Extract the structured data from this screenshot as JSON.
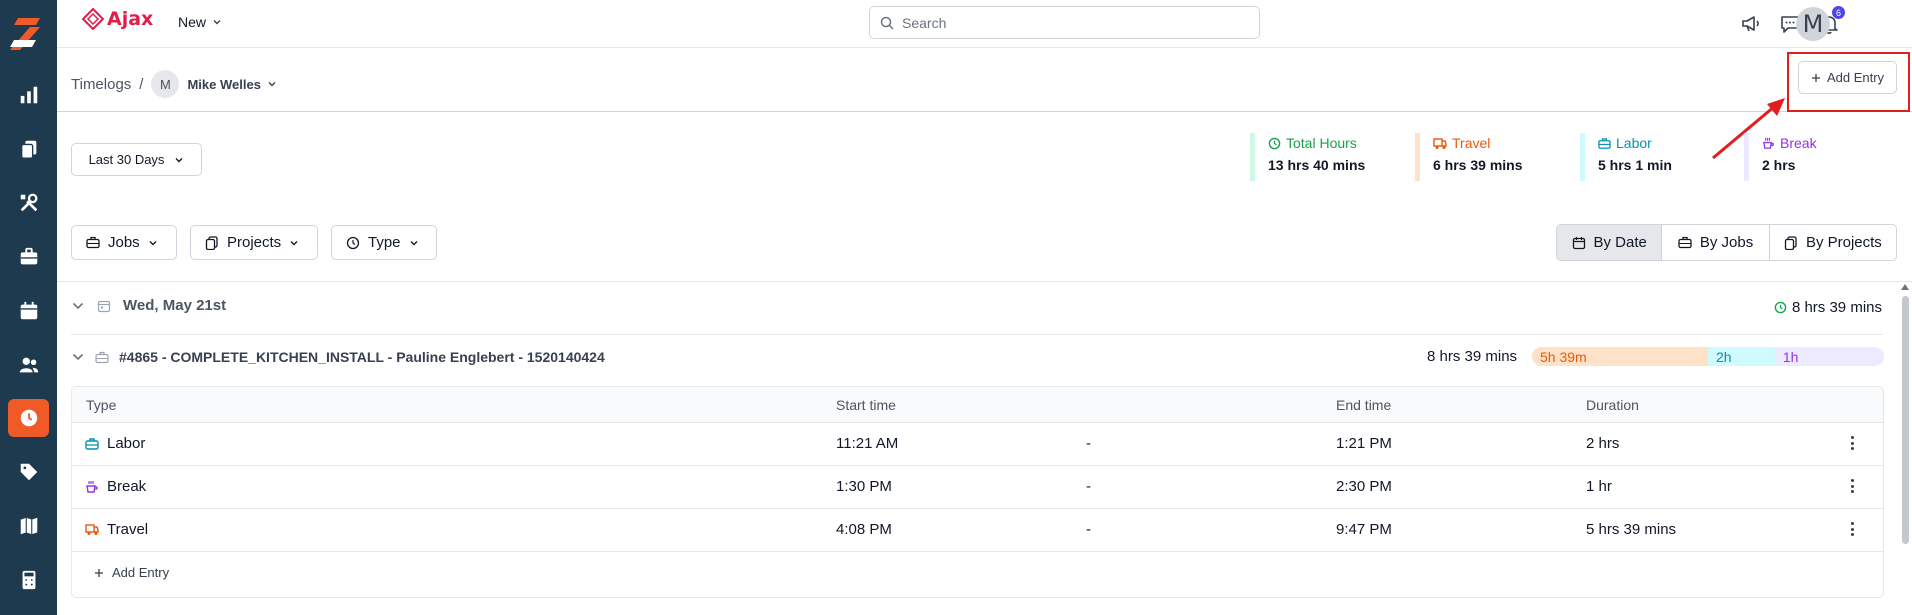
{
  "sidebar": {
    "items": [
      {
        "icon": "chart-icon",
        "active": false
      },
      {
        "icon": "documents-icon",
        "active": false
      },
      {
        "icon": "tools-icon",
        "active": false
      },
      {
        "icon": "briefcase-icon",
        "active": false
      },
      {
        "icon": "calendar-icon",
        "active": false
      },
      {
        "icon": "users-icon",
        "active": false
      },
      {
        "icon": "clock-icon",
        "active": true
      },
      {
        "icon": "tag-icon",
        "active": false
      },
      {
        "icon": "map-icon",
        "active": false
      },
      {
        "icon": "calculator-icon",
        "active": false
      }
    ],
    "active_color": "#f05a28",
    "bg_color": "#1e3a4f"
  },
  "topbar": {
    "brand": "Ajax",
    "new_label": "New",
    "search_placeholder": "Search",
    "notification_count": "6",
    "avatar_initial": "M"
  },
  "breadcrumb": {
    "root": "Timelogs",
    "separator": "/",
    "user_initial": "M",
    "user_name": "Mike Welles"
  },
  "add_entry_label": "Add Entry",
  "date_range": "Last 30 Days",
  "stats": [
    {
      "label": "Total Hours",
      "value": "13 hrs 40 mins",
      "color": "#16a34a",
      "bar_color": "#d1fae5",
      "icon": "clock-icon"
    },
    {
      "label": "Travel",
      "value": "6 hrs 39 mins",
      "color": "#ea580c",
      "bar_color": "#fde2c8",
      "icon": "truck-icon"
    },
    {
      "label": "Labor",
      "value": "5 hrs 1 min",
      "color": "#0891b2",
      "bar_color": "#cffafe",
      "icon": "toolbox-icon"
    },
    {
      "label": "Break",
      "value": "2 hrs",
      "color": "#9333ea",
      "bar_color": "#ede9fe",
      "icon": "coffee-icon"
    }
  ],
  "filters": {
    "jobs": "Jobs",
    "projects": "Projects",
    "type": "Type"
  },
  "views": {
    "by_date": "By Date",
    "by_jobs": "By Jobs",
    "by_projects": "By Projects",
    "active": "By Date"
  },
  "day_group": {
    "date": "Wed, May 21st",
    "total": "8 hrs 39 mins"
  },
  "job_group": {
    "title": "#4865 - COMPLETE_KITCHEN_INSTALL - Pauline Englebert - 1520140424",
    "total": "8 hrs 39 mins",
    "breakdown": [
      {
        "label": "5h 39m",
        "fraction": 0.5,
        "bg": "#fde2c8",
        "color": "#ea580c"
      },
      {
        "label": "2h",
        "fraction": 0.19,
        "bg": "#cffafe",
        "color": "#0891b2"
      },
      {
        "label": "1h",
        "fraction": 0.18,
        "bg": "#ede9fe",
        "color": "#9333ea"
      }
    ]
  },
  "table": {
    "headers": {
      "type": "Type",
      "start": "Start time",
      "end": "End time",
      "duration": "Duration"
    },
    "rows": [
      {
        "type": "Labor",
        "icon": "toolbox-icon",
        "icon_color": "#0891b2",
        "start": "11:21 AM",
        "sep": "-",
        "end": "1:21 PM",
        "duration": "2 hrs"
      },
      {
        "type": "Break",
        "icon": "coffee-icon",
        "icon_color": "#9333ea",
        "start": "1:30 PM",
        "sep": "-",
        "end": "2:30 PM",
        "duration": "1 hr"
      },
      {
        "type": "Travel",
        "icon": "truck-icon",
        "icon_color": "#ea580c",
        "start": "4:08 PM",
        "sep": "-",
        "end": "9:47 PM",
        "duration": "5 hrs 39 mins"
      }
    ],
    "add_entry_label": "Add Entry"
  }
}
